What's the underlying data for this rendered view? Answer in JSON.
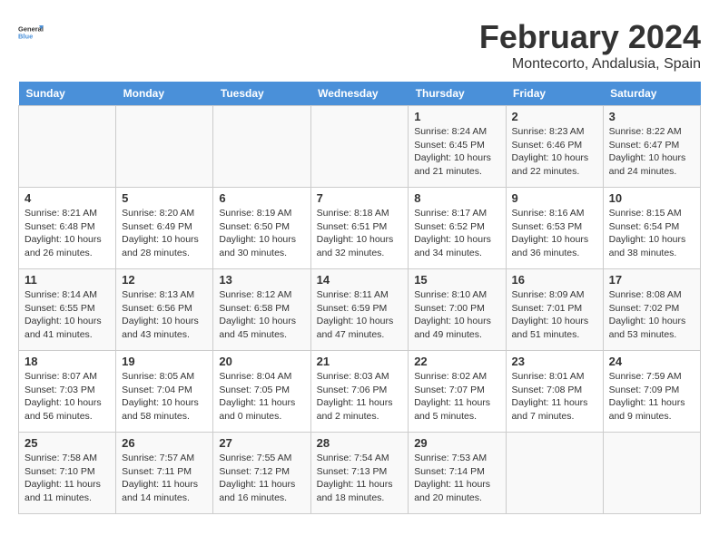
{
  "header": {
    "logo_general": "General",
    "logo_blue": "Blue",
    "month_year": "February 2024",
    "location": "Montecorto, Andalusia, Spain"
  },
  "weekdays": [
    "Sunday",
    "Monday",
    "Tuesday",
    "Wednesday",
    "Thursday",
    "Friday",
    "Saturday"
  ],
  "weeks": [
    [
      {
        "day": "",
        "info": ""
      },
      {
        "day": "",
        "info": ""
      },
      {
        "day": "",
        "info": ""
      },
      {
        "day": "",
        "info": ""
      },
      {
        "day": "1",
        "info": "Sunrise: 8:24 AM\nSunset: 6:45 PM\nDaylight: 10 hours\nand 21 minutes."
      },
      {
        "day": "2",
        "info": "Sunrise: 8:23 AM\nSunset: 6:46 PM\nDaylight: 10 hours\nand 22 minutes."
      },
      {
        "day": "3",
        "info": "Sunrise: 8:22 AM\nSunset: 6:47 PM\nDaylight: 10 hours\nand 24 minutes."
      }
    ],
    [
      {
        "day": "4",
        "info": "Sunrise: 8:21 AM\nSunset: 6:48 PM\nDaylight: 10 hours\nand 26 minutes."
      },
      {
        "day": "5",
        "info": "Sunrise: 8:20 AM\nSunset: 6:49 PM\nDaylight: 10 hours\nand 28 minutes."
      },
      {
        "day": "6",
        "info": "Sunrise: 8:19 AM\nSunset: 6:50 PM\nDaylight: 10 hours\nand 30 minutes."
      },
      {
        "day": "7",
        "info": "Sunrise: 8:18 AM\nSunset: 6:51 PM\nDaylight: 10 hours\nand 32 minutes."
      },
      {
        "day": "8",
        "info": "Sunrise: 8:17 AM\nSunset: 6:52 PM\nDaylight: 10 hours\nand 34 minutes."
      },
      {
        "day": "9",
        "info": "Sunrise: 8:16 AM\nSunset: 6:53 PM\nDaylight: 10 hours\nand 36 minutes."
      },
      {
        "day": "10",
        "info": "Sunrise: 8:15 AM\nSunset: 6:54 PM\nDaylight: 10 hours\nand 38 minutes."
      }
    ],
    [
      {
        "day": "11",
        "info": "Sunrise: 8:14 AM\nSunset: 6:55 PM\nDaylight: 10 hours\nand 41 minutes."
      },
      {
        "day": "12",
        "info": "Sunrise: 8:13 AM\nSunset: 6:56 PM\nDaylight: 10 hours\nand 43 minutes."
      },
      {
        "day": "13",
        "info": "Sunrise: 8:12 AM\nSunset: 6:58 PM\nDaylight: 10 hours\nand 45 minutes."
      },
      {
        "day": "14",
        "info": "Sunrise: 8:11 AM\nSunset: 6:59 PM\nDaylight: 10 hours\nand 47 minutes."
      },
      {
        "day": "15",
        "info": "Sunrise: 8:10 AM\nSunset: 7:00 PM\nDaylight: 10 hours\nand 49 minutes."
      },
      {
        "day": "16",
        "info": "Sunrise: 8:09 AM\nSunset: 7:01 PM\nDaylight: 10 hours\nand 51 minutes."
      },
      {
        "day": "17",
        "info": "Sunrise: 8:08 AM\nSunset: 7:02 PM\nDaylight: 10 hours\nand 53 minutes."
      }
    ],
    [
      {
        "day": "18",
        "info": "Sunrise: 8:07 AM\nSunset: 7:03 PM\nDaylight: 10 hours\nand 56 minutes."
      },
      {
        "day": "19",
        "info": "Sunrise: 8:05 AM\nSunset: 7:04 PM\nDaylight: 10 hours\nand 58 minutes."
      },
      {
        "day": "20",
        "info": "Sunrise: 8:04 AM\nSunset: 7:05 PM\nDaylight: 11 hours\nand 0 minutes."
      },
      {
        "day": "21",
        "info": "Sunrise: 8:03 AM\nSunset: 7:06 PM\nDaylight: 11 hours\nand 2 minutes."
      },
      {
        "day": "22",
        "info": "Sunrise: 8:02 AM\nSunset: 7:07 PM\nDaylight: 11 hours\nand 5 minutes."
      },
      {
        "day": "23",
        "info": "Sunrise: 8:01 AM\nSunset: 7:08 PM\nDaylight: 11 hours\nand 7 minutes."
      },
      {
        "day": "24",
        "info": "Sunrise: 7:59 AM\nSunset: 7:09 PM\nDaylight: 11 hours\nand 9 minutes."
      }
    ],
    [
      {
        "day": "25",
        "info": "Sunrise: 7:58 AM\nSunset: 7:10 PM\nDaylight: 11 hours\nand 11 minutes."
      },
      {
        "day": "26",
        "info": "Sunrise: 7:57 AM\nSunset: 7:11 PM\nDaylight: 11 hours\nand 14 minutes."
      },
      {
        "day": "27",
        "info": "Sunrise: 7:55 AM\nSunset: 7:12 PM\nDaylight: 11 hours\nand 16 minutes."
      },
      {
        "day": "28",
        "info": "Sunrise: 7:54 AM\nSunset: 7:13 PM\nDaylight: 11 hours\nand 18 minutes."
      },
      {
        "day": "29",
        "info": "Sunrise: 7:53 AM\nSunset: 7:14 PM\nDaylight: 11 hours\nand 20 minutes."
      },
      {
        "day": "",
        "info": ""
      },
      {
        "day": "",
        "info": ""
      }
    ]
  ]
}
